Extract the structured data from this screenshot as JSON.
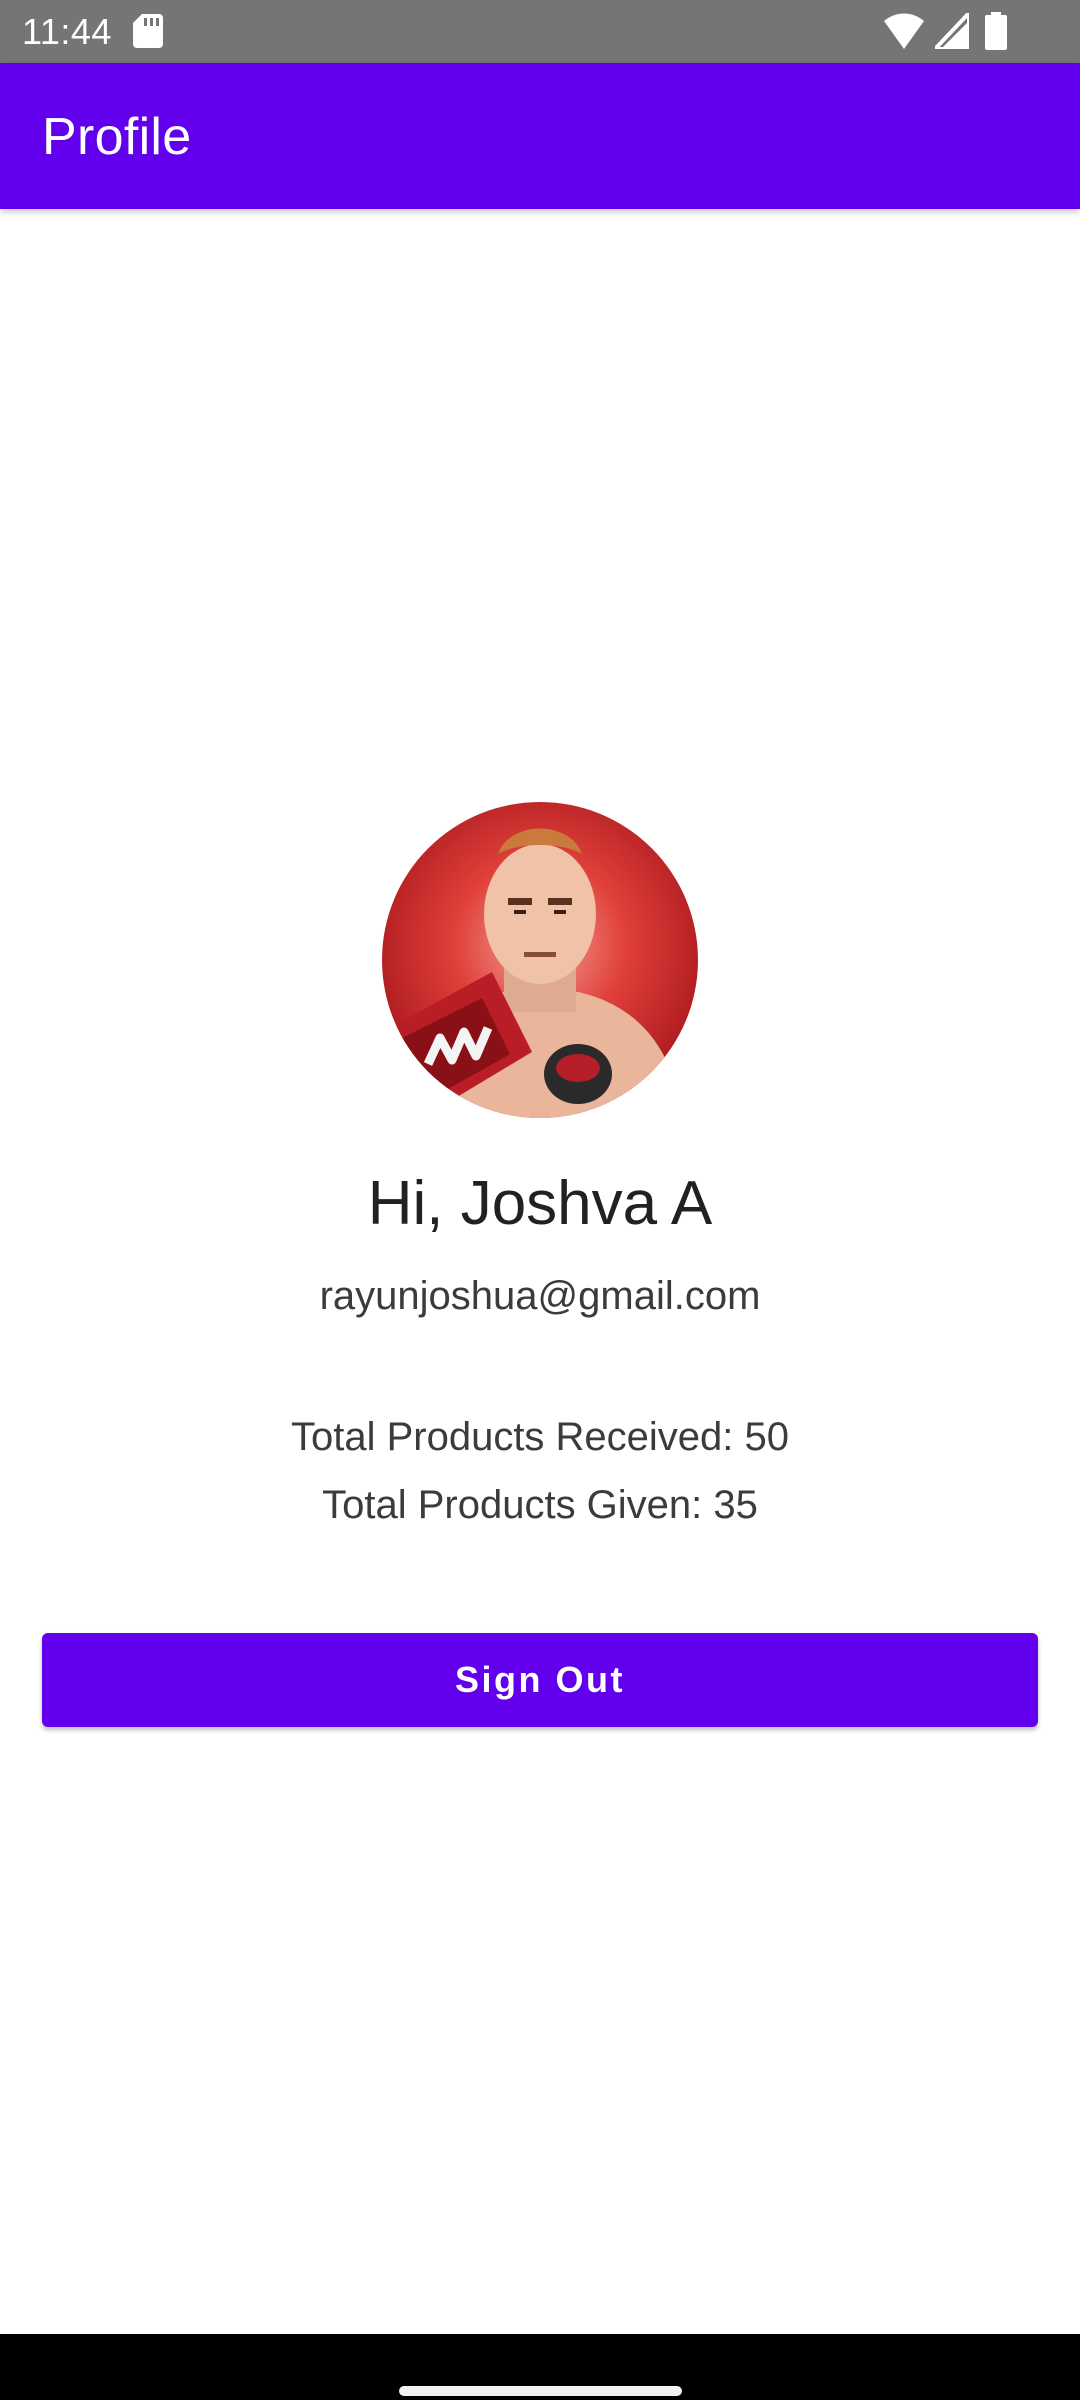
{
  "status_bar": {
    "time": "11:44",
    "icons": [
      "sd-card-icon",
      "wifi-icon",
      "signal-icon",
      "battery-icon"
    ]
  },
  "app_bar": {
    "title": "Profile",
    "color": "#6200ee"
  },
  "profile": {
    "avatar": "wrestler-avatar",
    "greeting": "Hi, Joshva A",
    "email": "rayunjoshua@gmail.com",
    "products_received": "Total Products Received: 50",
    "products_given": "Total Products Given: 35"
  },
  "actions": {
    "sign_out_label": "Sign Out"
  },
  "colors": {
    "accent": "#6200ee",
    "status_bar": "#757575",
    "nav_bar": "#000000"
  }
}
